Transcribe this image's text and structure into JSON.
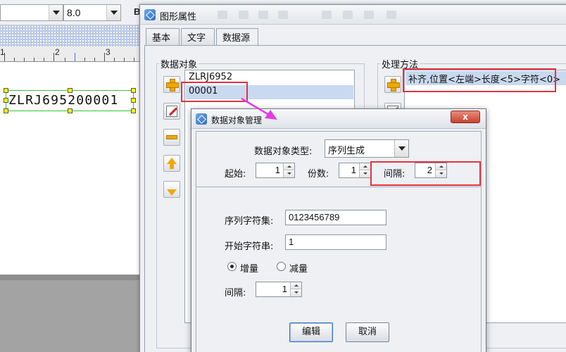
{
  "toolbar": {
    "font_size": "8.0",
    "bold_label": "B"
  },
  "ruler": {
    "marks": [
      "1",
      "2",
      "3"
    ]
  },
  "canvas": {
    "barcode_text": "ZLRJ695200001"
  },
  "props_dialog": {
    "title": "图形属性",
    "tabs": [
      {
        "label": "基本"
      },
      {
        "label": "文字"
      },
      {
        "label": "数据源",
        "active": true
      }
    ],
    "data_objects": {
      "title": "数据对象",
      "items": [
        "ZLRJ6952",
        "00001"
      ],
      "selected_index": 1
    },
    "processing": {
      "title": "处理方法",
      "items": [
        "补齐,位置<左端>长度<5>字符<0>"
      ]
    }
  },
  "sub_dialog": {
    "title": "数据对象管理",
    "close_label": "x",
    "type_label": "数据对象类型:",
    "type_value": "序列生成",
    "start_label": "起始:",
    "start_value": "1",
    "copies_label": "份数:",
    "copies_value": "1",
    "interval_label": "间隔:",
    "interval_value": "2",
    "charset_label": "序列字符集:",
    "charset_value": "0123456789",
    "start_string_label": "开始字符串:",
    "start_string_value": "1",
    "increment_label": "增量",
    "decrement_label": "减量",
    "direction_selected": "increment",
    "step_label": "间隔:",
    "step_value": "1",
    "edit_button": "编辑",
    "cancel_button": "取消"
  },
  "colors": {
    "highlight_frame": "#e2333f",
    "pointer_arrow": "#e23ce6",
    "selection": "#c9d9ef",
    "barcode_frame": "#38c238",
    "handle": "#ffff00"
  }
}
